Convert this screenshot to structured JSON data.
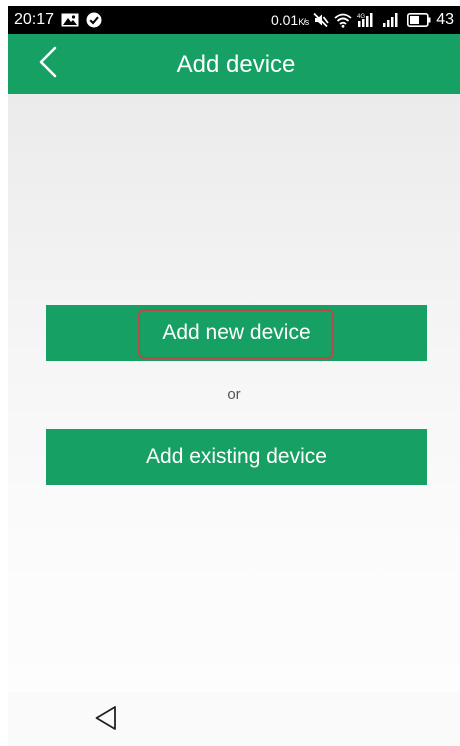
{
  "status_bar": {
    "time": "20:17",
    "data_speed": "0.01",
    "data_unit": "K/s",
    "battery": "43",
    "icons": [
      "gallery-icon",
      "check-circle-icon",
      "mute-icon",
      "wifi-icon",
      "signal-4g-icon",
      "signal-icon",
      "battery-icon"
    ]
  },
  "app_bar": {
    "title": "Add device",
    "back_icon": "chevron-left-icon",
    "color": "#16a063"
  },
  "main": {
    "add_new_label": "Add new device",
    "or_label": "or",
    "add_existing_label": "Add existing device",
    "highlight_color": "#b84a4a"
  },
  "nav_bar": {
    "back_icon": "triangle-back-icon"
  }
}
